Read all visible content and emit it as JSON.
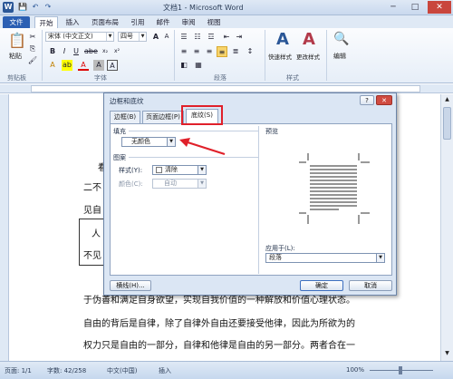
{
  "window": {
    "title": "文档1 - Microsoft Word",
    "controls": [
      "─",
      "□",
      "✕"
    ]
  },
  "quick_access": [
    "W",
    "💾",
    "↶",
    "↷"
  ],
  "tabs": [
    {
      "label": "文件"
    },
    {
      "label": "开始"
    },
    {
      "label": "插入"
    },
    {
      "label": "页面布局"
    },
    {
      "label": "引用"
    },
    {
      "label": "邮件"
    },
    {
      "label": "审阅"
    },
    {
      "label": "视图"
    }
  ],
  "ribbon": {
    "clipboard": {
      "group": "剪贴板",
      "paste": "粘贴"
    },
    "font": {
      "group": "字体",
      "name": "宋体 (中文正文)",
      "size": "四号"
    },
    "paragraph": {
      "group": "段落"
    },
    "styles": {
      "group": "样式",
      "quick_styles": "快速样式",
      "change_styles": "更改样式"
    },
    "editing": {
      "label": "编辑"
    }
  },
  "document": {
    "lines": [
      "看",
      "二不",
      "见自",
      "人",
      "不见",
      "于伪善和满足自身欲望，实现自我价值的一种解放和价值心理状态。",
      "自由的背后是自律，除了自律外自由还要接受他律，因此为所欲为的",
      "权力只是自由的一部分，自律和他律是自由的另一部分。两者合在一"
    ]
  },
  "dialog": {
    "title": "边框和底纹",
    "help": "?",
    "close": "✕",
    "tabs": [
      {
        "label": "边框(B)"
      },
      {
        "label": "页面边框(P)"
      },
      {
        "label": "底纹(S)"
      }
    ],
    "fill": {
      "label": "填充",
      "value": "无颜色"
    },
    "pattern": {
      "label": "图案",
      "style_label": "样式(Y):",
      "style_value": "清除",
      "color_label": "颜色(C):",
      "color_value": "自动"
    },
    "preview": {
      "label": "预览"
    },
    "apply_to": {
      "label": "应用于(L):",
      "value": "段落"
    },
    "buttons": {
      "hline": "横线(H)...",
      "ok": "确定",
      "cancel": "取消"
    }
  },
  "statusbar": {
    "page": "页面: 1/1",
    "words": "字数: 42/258",
    "language": "中文(中国)",
    "mode": "插入",
    "zoom": "100%"
  },
  "colors": {
    "accent": "#2b5fb3",
    "highlight_box": "#e0202a",
    "arrow": "#e0202a"
  }
}
